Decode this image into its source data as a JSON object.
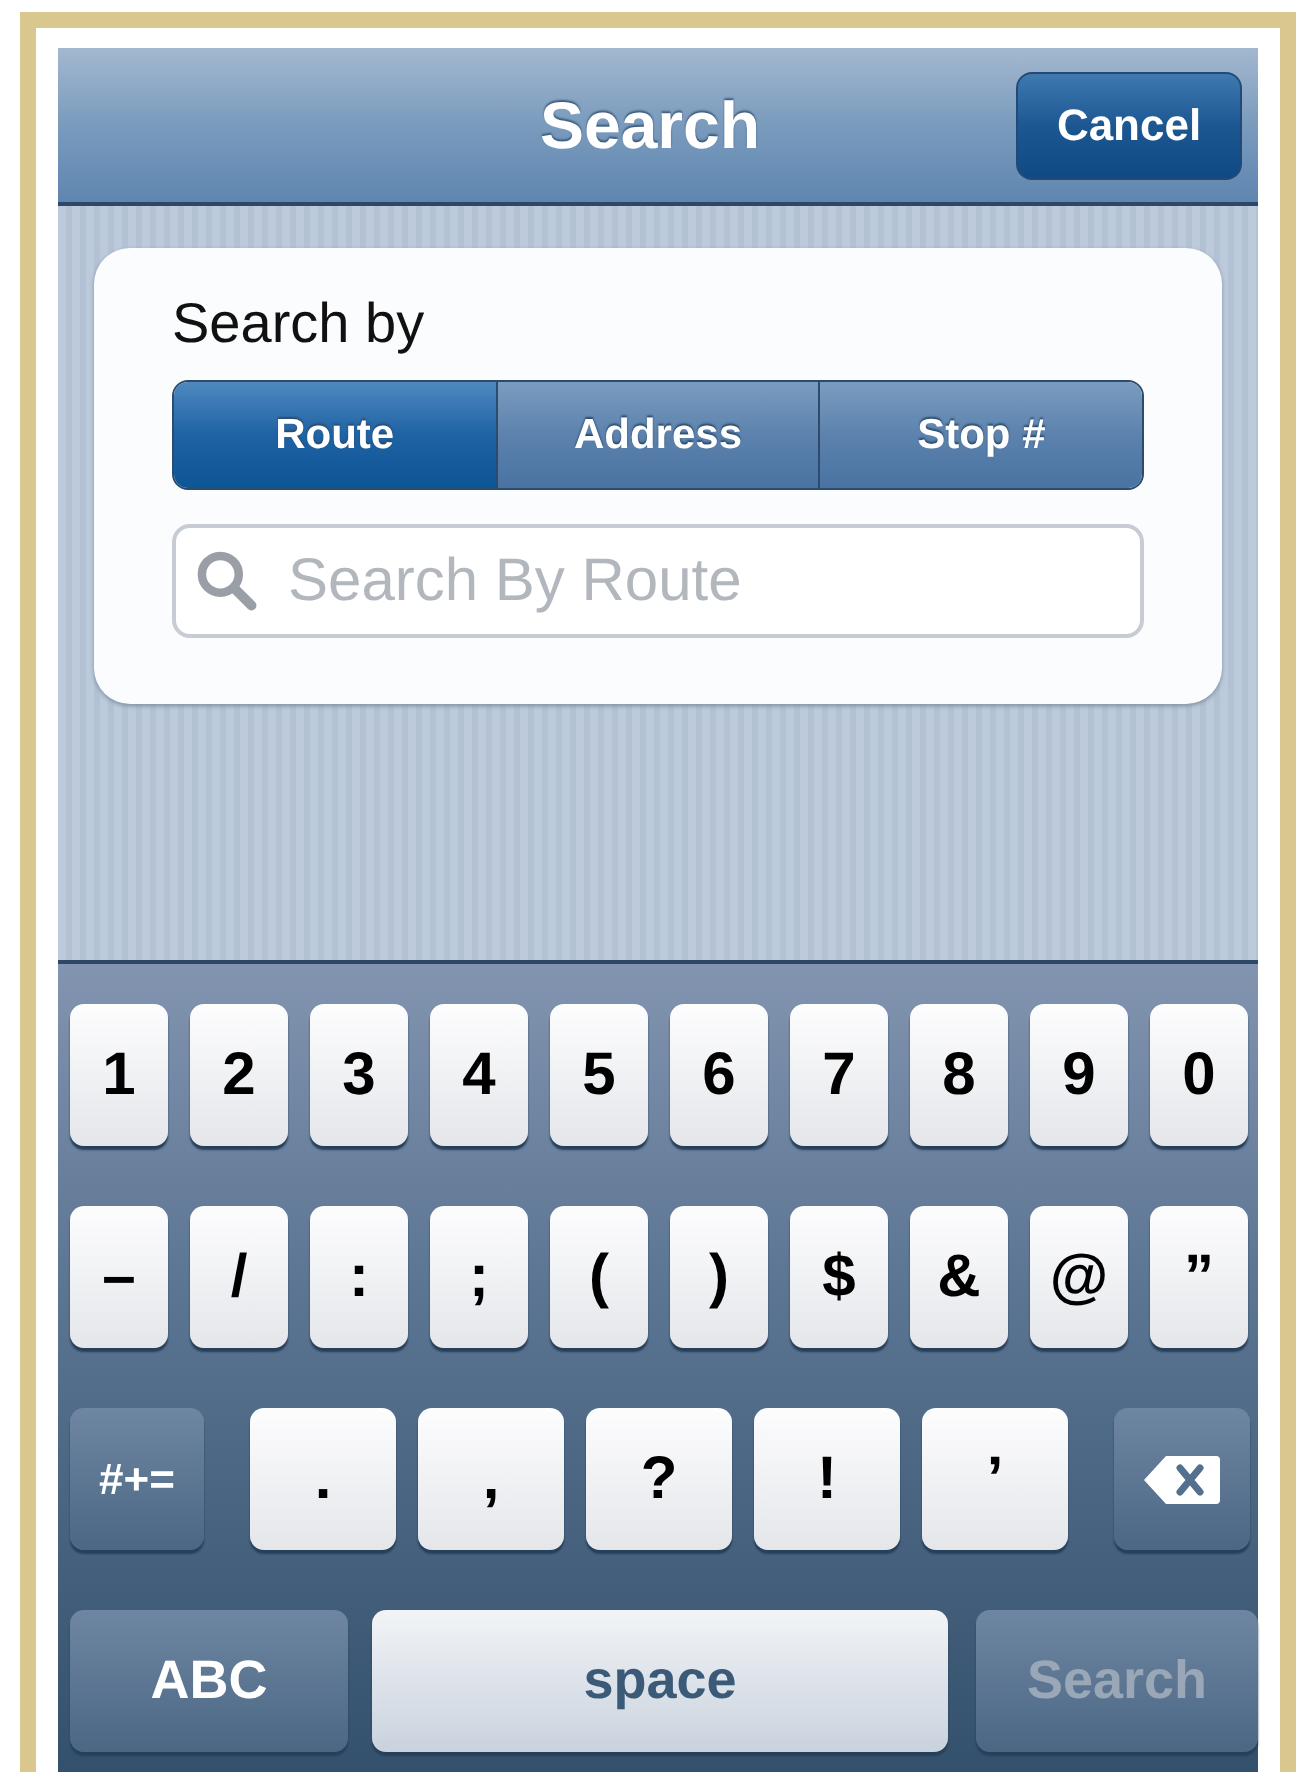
{
  "nav_bar": {
    "title": "Search",
    "cancel_button": "Cancel"
  },
  "search_card": {
    "label": "Search by",
    "segments": [
      {
        "label": "Route",
        "selected": true
      },
      {
        "label": "Address",
        "selected": false
      },
      {
        "label": "Stop #",
        "selected": false
      }
    ],
    "search_field": {
      "placeholder": "Search By Route"
    }
  },
  "keyboard": {
    "number_row": [
      {
        "kind": "char",
        "label": "1"
      },
      {
        "kind": "char",
        "label": "2"
      },
      {
        "kind": "char",
        "label": "3"
      },
      {
        "kind": "char",
        "label": "4"
      },
      {
        "kind": "char",
        "label": "5"
      },
      {
        "kind": "char",
        "label": "6"
      },
      {
        "kind": "char",
        "label": "7"
      },
      {
        "kind": "char",
        "label": "8"
      },
      {
        "kind": "char",
        "label": "9"
      },
      {
        "kind": "char",
        "label": "0"
      }
    ],
    "symbol_row": [
      {
        "kind": "char",
        "label": "–"
      },
      {
        "kind": "char",
        "label": "/"
      },
      {
        "kind": "char",
        "label": ":"
      },
      {
        "kind": "char",
        "label": ";"
      },
      {
        "kind": "char",
        "label": "("
      },
      {
        "kind": "char",
        "label": ")"
      },
      {
        "kind": "char",
        "label": "$"
      },
      {
        "kind": "char",
        "label": "&"
      },
      {
        "kind": "char",
        "label": "@"
      },
      {
        "kind": "char",
        "label": "”"
      }
    ],
    "punctuation_row": [
      {
        "kind": "mode",
        "label": "#+="
      },
      {
        "kind": "wide",
        "label": "."
      },
      {
        "kind": "wide",
        "label": ","
      },
      {
        "kind": "wide",
        "label": "?"
      },
      {
        "kind": "wide",
        "label": "!"
      },
      {
        "kind": "wide",
        "label": "’"
      },
      {
        "kind": "delete"
      }
    ],
    "bottom_row": [
      {
        "kind": "mode",
        "label": "ABC"
      },
      {
        "kind": "space",
        "label": "space"
      },
      {
        "kind": "action",
        "label": "Search",
        "disabled": true
      }
    ]
  }
}
